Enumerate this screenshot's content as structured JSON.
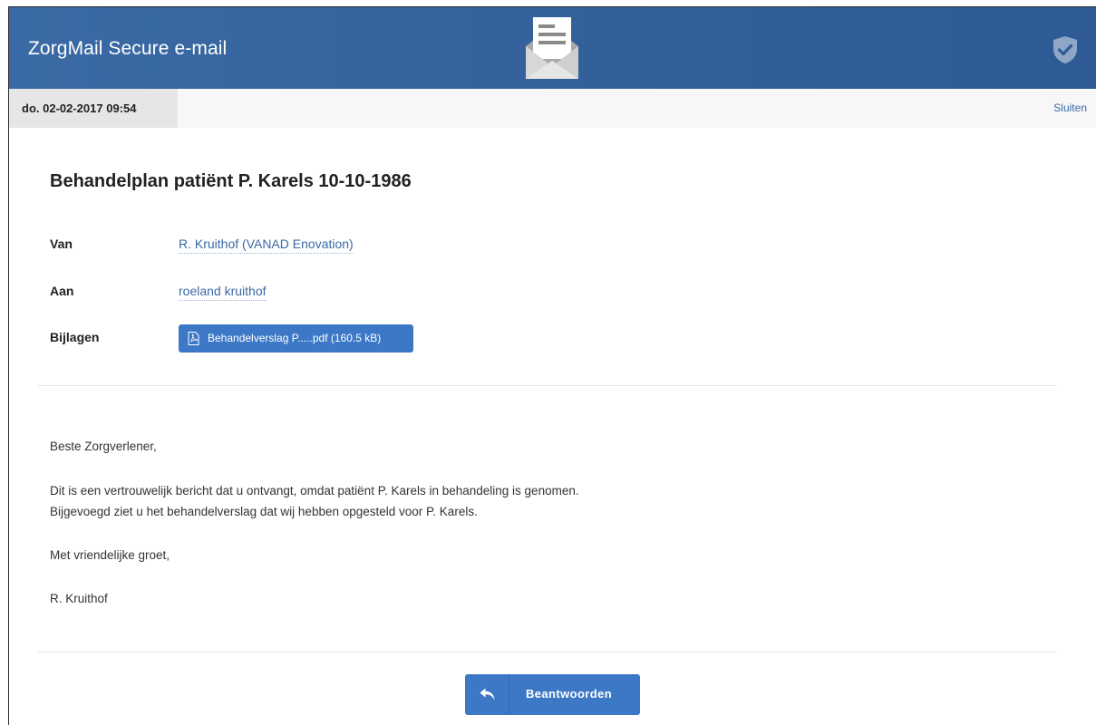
{
  "app": {
    "title": "ZorgMail Secure e-mail",
    "logo_icon": "envelope-logo-icon",
    "security_icon": "shield-check-icon",
    "header_color": "#3a6aa5"
  },
  "toolbar": {
    "date": "do. 02-02-2017 09:54",
    "close_label": "Sluiten"
  },
  "message": {
    "subject": "Behandelplan patiënt P. Karels 10-10-1986",
    "from_label": "Van",
    "from_value": "R. Kruithof (VANAD Enovation)",
    "to_label": "Aan",
    "to_value": "roeland kruithof",
    "attachments_label": "Bijlagen",
    "attachments": [
      {
        "name": "Behandelverslag P.....pdf (160.5 kB)",
        "icon": "pdf-file-icon"
      }
    ],
    "body": {
      "greeting": "Beste Zorgverlener,",
      "line1": "Dit is een vertrouwelijk bericht dat u ontvangt, omdat patiënt P. Karels in behandeling is genomen.",
      "line2": "Bijgevoegd ziet u het behandelverslag dat wij hebben opgesteld voor P. Karels.",
      "closing": "Met vriendelijke groet,",
      "signature": "R. Kruithof"
    }
  },
  "actions": {
    "reply_label": "Beantwoorden",
    "reply_icon": "reply-arrow-icon",
    "button_color": "#3d78c6"
  }
}
